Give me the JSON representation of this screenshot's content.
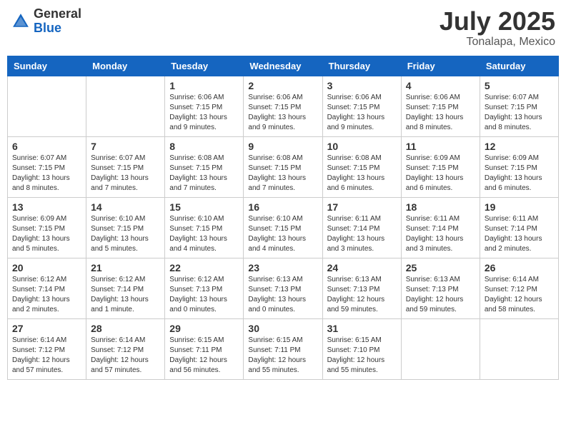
{
  "header": {
    "logo_general": "General",
    "logo_blue": "Blue",
    "month": "July 2025",
    "location": "Tonalapa, Mexico"
  },
  "days_of_week": [
    "Sunday",
    "Monday",
    "Tuesday",
    "Wednesday",
    "Thursday",
    "Friday",
    "Saturday"
  ],
  "weeks": [
    [
      {
        "day": "",
        "info": ""
      },
      {
        "day": "",
        "info": ""
      },
      {
        "day": "1",
        "info": "Sunrise: 6:06 AM\nSunset: 7:15 PM\nDaylight: 13 hours\nand 9 minutes."
      },
      {
        "day": "2",
        "info": "Sunrise: 6:06 AM\nSunset: 7:15 PM\nDaylight: 13 hours\nand 9 minutes."
      },
      {
        "day": "3",
        "info": "Sunrise: 6:06 AM\nSunset: 7:15 PM\nDaylight: 13 hours\nand 9 minutes."
      },
      {
        "day": "4",
        "info": "Sunrise: 6:06 AM\nSunset: 7:15 PM\nDaylight: 13 hours\nand 8 minutes."
      },
      {
        "day": "5",
        "info": "Sunrise: 6:07 AM\nSunset: 7:15 PM\nDaylight: 13 hours\nand 8 minutes."
      }
    ],
    [
      {
        "day": "6",
        "info": "Sunrise: 6:07 AM\nSunset: 7:15 PM\nDaylight: 13 hours\nand 8 minutes."
      },
      {
        "day": "7",
        "info": "Sunrise: 6:07 AM\nSunset: 7:15 PM\nDaylight: 13 hours\nand 7 minutes."
      },
      {
        "day": "8",
        "info": "Sunrise: 6:08 AM\nSunset: 7:15 PM\nDaylight: 13 hours\nand 7 minutes."
      },
      {
        "day": "9",
        "info": "Sunrise: 6:08 AM\nSunset: 7:15 PM\nDaylight: 13 hours\nand 7 minutes."
      },
      {
        "day": "10",
        "info": "Sunrise: 6:08 AM\nSunset: 7:15 PM\nDaylight: 13 hours\nand 6 minutes."
      },
      {
        "day": "11",
        "info": "Sunrise: 6:09 AM\nSunset: 7:15 PM\nDaylight: 13 hours\nand 6 minutes."
      },
      {
        "day": "12",
        "info": "Sunrise: 6:09 AM\nSunset: 7:15 PM\nDaylight: 13 hours\nand 6 minutes."
      }
    ],
    [
      {
        "day": "13",
        "info": "Sunrise: 6:09 AM\nSunset: 7:15 PM\nDaylight: 13 hours\nand 5 minutes."
      },
      {
        "day": "14",
        "info": "Sunrise: 6:10 AM\nSunset: 7:15 PM\nDaylight: 13 hours\nand 5 minutes."
      },
      {
        "day": "15",
        "info": "Sunrise: 6:10 AM\nSunset: 7:15 PM\nDaylight: 13 hours\nand 4 minutes."
      },
      {
        "day": "16",
        "info": "Sunrise: 6:10 AM\nSunset: 7:15 PM\nDaylight: 13 hours\nand 4 minutes."
      },
      {
        "day": "17",
        "info": "Sunrise: 6:11 AM\nSunset: 7:14 PM\nDaylight: 13 hours\nand 3 minutes."
      },
      {
        "day": "18",
        "info": "Sunrise: 6:11 AM\nSunset: 7:14 PM\nDaylight: 13 hours\nand 3 minutes."
      },
      {
        "day": "19",
        "info": "Sunrise: 6:11 AM\nSunset: 7:14 PM\nDaylight: 13 hours\nand 2 minutes."
      }
    ],
    [
      {
        "day": "20",
        "info": "Sunrise: 6:12 AM\nSunset: 7:14 PM\nDaylight: 13 hours\nand 2 minutes."
      },
      {
        "day": "21",
        "info": "Sunrise: 6:12 AM\nSunset: 7:14 PM\nDaylight: 13 hours\nand 1 minute."
      },
      {
        "day": "22",
        "info": "Sunrise: 6:12 AM\nSunset: 7:13 PM\nDaylight: 13 hours\nand 0 minutes."
      },
      {
        "day": "23",
        "info": "Sunrise: 6:13 AM\nSunset: 7:13 PM\nDaylight: 13 hours\nand 0 minutes."
      },
      {
        "day": "24",
        "info": "Sunrise: 6:13 AM\nSunset: 7:13 PM\nDaylight: 12 hours\nand 59 minutes."
      },
      {
        "day": "25",
        "info": "Sunrise: 6:13 AM\nSunset: 7:13 PM\nDaylight: 12 hours\nand 59 minutes."
      },
      {
        "day": "26",
        "info": "Sunrise: 6:14 AM\nSunset: 7:12 PM\nDaylight: 12 hours\nand 58 minutes."
      }
    ],
    [
      {
        "day": "27",
        "info": "Sunrise: 6:14 AM\nSunset: 7:12 PM\nDaylight: 12 hours\nand 57 minutes."
      },
      {
        "day": "28",
        "info": "Sunrise: 6:14 AM\nSunset: 7:12 PM\nDaylight: 12 hours\nand 57 minutes."
      },
      {
        "day": "29",
        "info": "Sunrise: 6:15 AM\nSunset: 7:11 PM\nDaylight: 12 hours\nand 56 minutes."
      },
      {
        "day": "30",
        "info": "Sunrise: 6:15 AM\nSunset: 7:11 PM\nDaylight: 12 hours\nand 55 minutes."
      },
      {
        "day": "31",
        "info": "Sunrise: 6:15 AM\nSunset: 7:10 PM\nDaylight: 12 hours\nand 55 minutes."
      },
      {
        "day": "",
        "info": ""
      },
      {
        "day": "",
        "info": ""
      }
    ]
  ]
}
